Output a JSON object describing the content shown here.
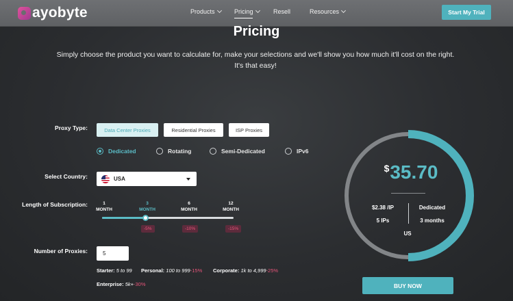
{
  "brand": {
    "logo_text": "ayobyte",
    "accent": "#4fb2bd",
    "discount_color": "#e8557a"
  },
  "nav": {
    "items": [
      {
        "label": "Products",
        "has_dropdown": true
      },
      {
        "label": "Pricing",
        "has_dropdown": true,
        "active": true
      },
      {
        "label": "Resell",
        "has_dropdown": false
      },
      {
        "label": "Resources",
        "has_dropdown": true
      }
    ],
    "cta_label": "Start My Trial"
  },
  "page": {
    "title": "Pricing",
    "subtitle": "Simply choose the product you want to calculate for, make your selections and we'll show you how much it'll cost on the right. It's that easy!"
  },
  "proxy_type": {
    "label": "Proxy Type:",
    "options": [
      "Data Center Proxies",
      "Residential Proxies",
      "ISP Proxies"
    ],
    "selected": "Data Center Proxies",
    "subtypes": [
      "Dedicated",
      "Rotating",
      "Semi-Dedicated",
      "IPv6"
    ],
    "selected_subtype": "Dedicated"
  },
  "country": {
    "label": "Select Country:",
    "value": "USA",
    "icon": "us-flag-icon"
  },
  "subscription": {
    "label": "Length of Subscription:",
    "months": [
      {
        "value": "1",
        "unit": "MONTH",
        "discount": ""
      },
      {
        "value": "3",
        "unit": "MONTH",
        "discount": "-5%"
      },
      {
        "value": "6",
        "unit": "MONTH",
        "discount": "-10%"
      },
      {
        "value": "12",
        "unit": "MONTH",
        "discount": "-15%"
      }
    ],
    "selected_index": 1,
    "slider_fraction": 0.3333
  },
  "quantity": {
    "label": "Number of Proxies:",
    "value": "5"
  },
  "tiers": [
    {
      "name": "Starter:",
      "range": "5 to 99",
      "discount": ""
    },
    {
      "name": "Personal:",
      "range": "100 to 999",
      "discount": "-15%"
    },
    {
      "name": "Corporate:",
      "range": "1k to 4,999",
      "discount": "-25%"
    },
    {
      "name": "Enterprise:",
      "range": "5k+",
      "discount": "-30%"
    }
  ],
  "summary": {
    "currency": "$",
    "price": "35.70",
    "per_ip": "$2.38 /IP",
    "ip_count": "5 IPs",
    "type": "Dedicated",
    "duration": "3 months",
    "country": "US",
    "ring_fill_fraction": 0.5,
    "buy_label": "BUY NOW"
  }
}
